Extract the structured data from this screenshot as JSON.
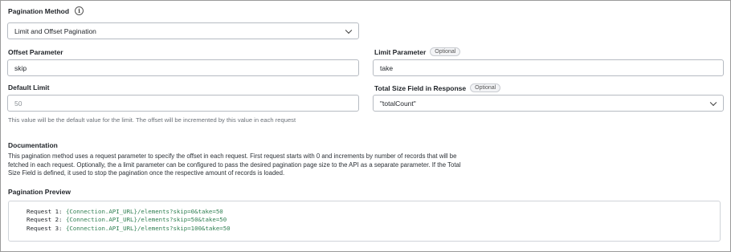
{
  "pagination_method": {
    "label": "Pagination Method",
    "info_icon": "info-icon",
    "selected": "Limit and Offset Pagination"
  },
  "offset_parameter": {
    "label": "Offset Parameter",
    "value": "skip"
  },
  "limit_parameter": {
    "label": "Limit Parameter",
    "badge": "Optional",
    "value": "take"
  },
  "default_limit": {
    "label": "Default Limit",
    "value": "50",
    "help": "This value will be the default value for the limit. The offset will be incremented by this value in each request"
  },
  "total_size_field": {
    "label": "Total Size Field in Response",
    "badge": "Optional",
    "selected": "\"totalCount\""
  },
  "documentation": {
    "heading": "Documentation",
    "lines": [
      "This pagination method uses a request parameter to specify the offset in each request. First request starts with 0 and increments by number of records that will be",
      "fetched in each request. Optionally, the a limit parameter can be configured to pass the desired pagination page size to the API as a separate parameter. If the Total",
      "Size Field is defined, it used to stop the pagination once the respective amount of records is loaded."
    ]
  },
  "preview": {
    "heading": "Pagination Preview",
    "requests": [
      {
        "prefix": "Request 1: ",
        "url": "{Connection.API_URL}/elements?skip=0&take=50"
      },
      {
        "prefix": "Request 2: ",
        "url": "{Connection.API_URL}/elements?skip=50&take=50"
      },
      {
        "prefix": "Request 3: ",
        "url": "{Connection.API_URL}/elements?skip=100&take=50"
      }
    ]
  }
}
